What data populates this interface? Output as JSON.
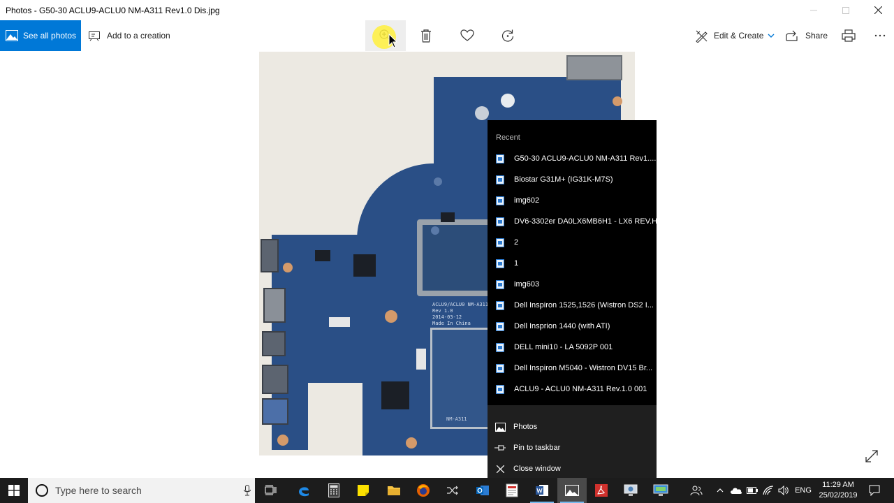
{
  "window": {
    "title": "Photos - G50-30 ACLU9-ACLU0 NM-A311 Rev1.0 Dis.jpg",
    "controls": [
      "minimize-icon",
      "maximize-icon",
      "close-icon"
    ]
  },
  "toolbar": {
    "see_all_photos": "See all photos",
    "add_to_creation": "Add to a creation",
    "zoom_icon": "zoom-in-icon",
    "delete_icon": "trash-icon",
    "favorite_icon": "heart-icon",
    "rotate_icon": "rotate-icon",
    "edit_create": "Edit & Create",
    "share": "Share",
    "print_icon": "print-icon",
    "more_icon": "ellipsis-icon"
  },
  "photo": {
    "silkscreen": [
      "ACLU9/ACLU0 NM-A311",
      "Rev 1.0",
      "2014-03-12",
      "Made In China"
    ],
    "label_sticker": "NM-A311"
  },
  "jumplist": {
    "header": "Recent",
    "recent": [
      "G50-30 ACLU9-ACLU0 NM-A311 Rev1....",
      "Biostar G31M+ (IG31K-M7S)",
      "img602",
      "DV6-3302er DA0LX6MB6H1 - LX6 REV.H",
      "2",
      "1",
      "img603",
      "Dell Inspiron 1525,1526 (Wistron DS2 I...",
      "Dell Insprion 1440 (with ATI)",
      "DELL mini10 - LA 5092P 001",
      "Dell Inspiron M5040 - Wistron DV15 Br...",
      "ACLU9 - ACLU0 NM-A311 Rev.1.0 001"
    ],
    "actions": {
      "app": "Photos",
      "pin": "Pin to taskbar",
      "close": "Close window"
    }
  },
  "taskbar": {
    "search_placeholder": "Type here to search",
    "apps": [
      "task-view",
      "edge",
      "calculator",
      "sticky-notes",
      "file-explorer",
      "firefox",
      "shuffle",
      "outlook",
      "pdf-reader",
      "word",
      "photos",
      "acrobat",
      "remote-app",
      "network-app"
    ],
    "tray": {
      "language": "ENG",
      "time": "11:29 AM",
      "date": "25/02/2019"
    }
  },
  "colors": {
    "accent": "#0078d7",
    "jumplist_bg": "#000000",
    "taskbar_bg": "#1c1c1c",
    "board_blue": "#2a4f86"
  }
}
